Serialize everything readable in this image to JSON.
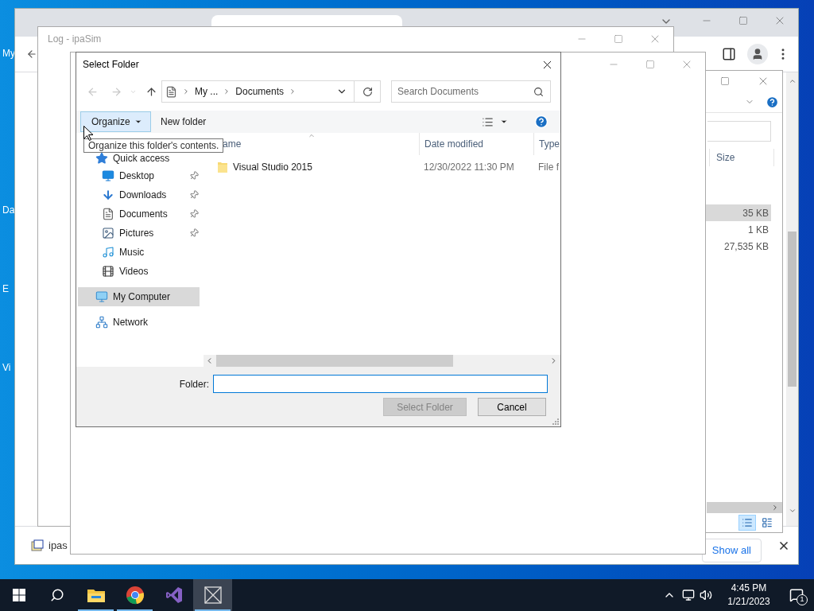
{
  "desktop": {
    "icon_labels": [
      "My",
      "Da",
      "E",
      "Vi"
    ]
  },
  "browser": {
    "download_bar": {
      "file": "ipas",
      "show_all": "Show all"
    }
  },
  "explorer": {
    "column": "Size",
    "rows": [
      {
        "size": "35 KB",
        "selected": true
      },
      {
        "size": "1 KB",
        "selected": false
      },
      {
        "size": "27,535 KB",
        "selected": false
      }
    ],
    "views": [
      {
        "kind": "details",
        "selected": true
      },
      {
        "kind": "thumbnails",
        "selected": false
      }
    ]
  },
  "log_window": {
    "title": "Log - ipaSim"
  },
  "dialog": {
    "title": "Select Folder",
    "breadcrumb": [
      "My ...",
      "Documents"
    ],
    "search": {
      "placeholder": "Search Documents"
    },
    "toolbar": [
      {
        "label": "Organize",
        "kind": "menu",
        "hovered": true
      },
      {
        "label": "New folder",
        "kind": "plain",
        "hovered": false
      }
    ],
    "tooltip": "Organize this folder's contents.",
    "nav": [
      {
        "label": "Quick access",
        "kind": "star",
        "selected": false,
        "children": [
          {
            "label": "Desktop",
            "kind": "desktop",
            "pinned": true
          },
          {
            "label": "Downloads",
            "kind": "downloads",
            "pinned": true
          },
          {
            "label": "Documents",
            "kind": "documents",
            "pinned": true
          },
          {
            "label": "Pictures",
            "kind": "pictures",
            "pinned": true
          },
          {
            "label": "Music",
            "kind": "music",
            "pinned": false
          },
          {
            "label": "Videos",
            "kind": "videos",
            "pinned": false
          }
        ]
      },
      {
        "label": "My Computer",
        "kind": "computer",
        "selected": true
      },
      {
        "label": "Network",
        "kind": "network",
        "selected": false
      }
    ],
    "columns": [
      {
        "label": "ame",
        "sorted": true
      },
      {
        "label": "Date modified",
        "sorted": false
      },
      {
        "label": "Type",
        "sorted": false
      }
    ],
    "files": [
      {
        "name": "Visual Studio 2015",
        "date": "12/30/2022 11:30 PM",
        "type": "File f"
      }
    ],
    "folder_label": "Folder:",
    "buttons": [
      {
        "label": "Select Folder",
        "disabled": true
      },
      {
        "label": "Cancel",
        "disabled": false
      }
    ]
  },
  "taskbar": {
    "apps": [
      {
        "kind": "explorer",
        "running": true,
        "active": false
      },
      {
        "kind": "chrome",
        "running": true,
        "active": false
      },
      {
        "kind": "visualstudio",
        "running": false,
        "active": false
      },
      {
        "kind": "app",
        "running": true,
        "active": true
      }
    ],
    "time": "4:45 PM",
    "date": "1/21/2023",
    "notifications": "1"
  }
}
